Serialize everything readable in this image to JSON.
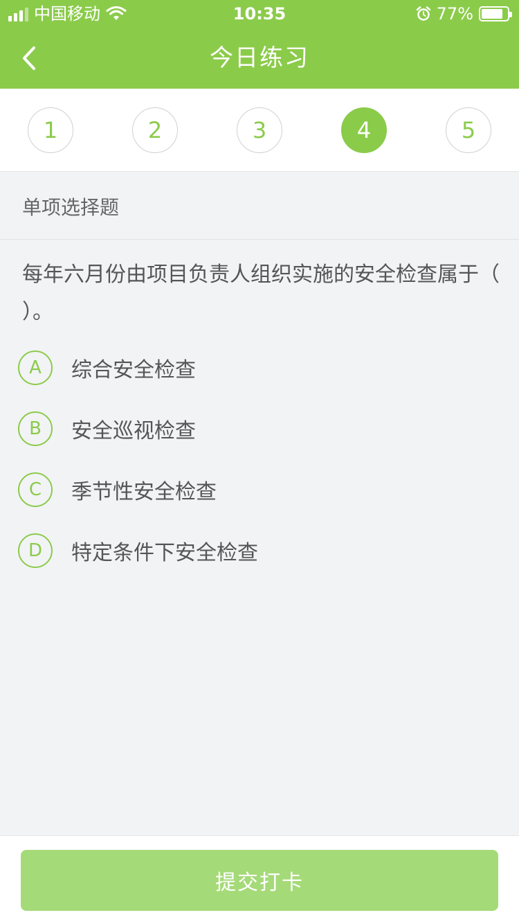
{
  "status_bar": {
    "carrier": "中国移动",
    "time": "10:35",
    "battery": "77%",
    "battery_level": 0.77
  },
  "nav": {
    "title": "今日练习",
    "back_icon": "chevron-left-icon"
  },
  "question_tabs": [
    {
      "label": "1",
      "active": false
    },
    {
      "label": "2",
      "active": false
    },
    {
      "label": "3",
      "active": false
    },
    {
      "label": "4",
      "active": true
    },
    {
      "label": "5",
      "active": false
    }
  ],
  "question": {
    "type": "单项选择题",
    "text": "每年六月份由项目负责人组织实施的安全检查属于（ ）。",
    "options": [
      {
        "letter": "A",
        "text": "综合安全检查"
      },
      {
        "letter": "B",
        "text": "安全巡视检查"
      },
      {
        "letter": "C",
        "text": "季节性安全检查"
      },
      {
        "letter": "D",
        "text": "特定条件下安全检查"
      }
    ]
  },
  "footer": {
    "submit_label": "提交打卡"
  },
  "colors": {
    "primary": "#8bcb4a",
    "submit_disabled": "#a5da78"
  }
}
